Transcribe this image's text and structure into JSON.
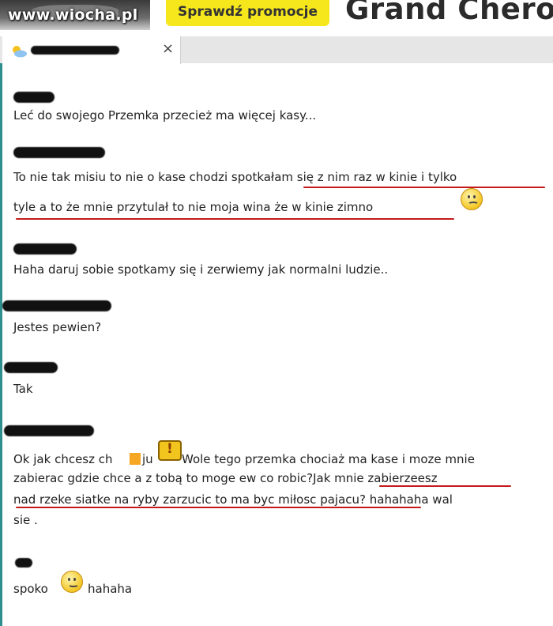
{
  "banner": {
    "watermark": "www.wiocha.pl",
    "promo_label": "Sprawdź promocje",
    "model_name": "Grand Chero"
  },
  "tab": {
    "close_glyph": "×"
  },
  "messages": [
    {
      "line1": "Leć do swojego Przemka przecież ma więcej kasy..."
    },
    {
      "line1": "To nie tak misiu to nie o kase chodzi spotkałam się z nim raz w kinie i tylko",
      "line2": "tyle a to że mnie przytulał  to nie moja wina że w kinie zimno"
    },
    {
      "line1": "Haha daruj sobie spotkamy się i zerwiemy jak normalni ludzie.."
    },
    {
      "line1": "Jestes pewien?"
    },
    {
      "line1": "Tak"
    },
    {
      "line1a": "Ok jak chcesz ch",
      "line1b": "ju",
      "line1c": "Wole tego przemka chociaż ma kase i moze mnie",
      "line2": "zabierac gdzie chce a z tobą to moge ew co robic?Jak mnie zabierzeesz",
      "line3": "nad rzeke siatke na ryby zarzucic to ma byc miłosc pajacu? hahahaha wal",
      "line4": "sie ."
    },
    {
      "line1a": "spoko",
      "line1b": "hahaha"
    }
  ],
  "colors": {
    "accent_underline": "#c41a1a",
    "promo_bg": "#f5e71c",
    "border_teal": "#2e8f8f"
  }
}
